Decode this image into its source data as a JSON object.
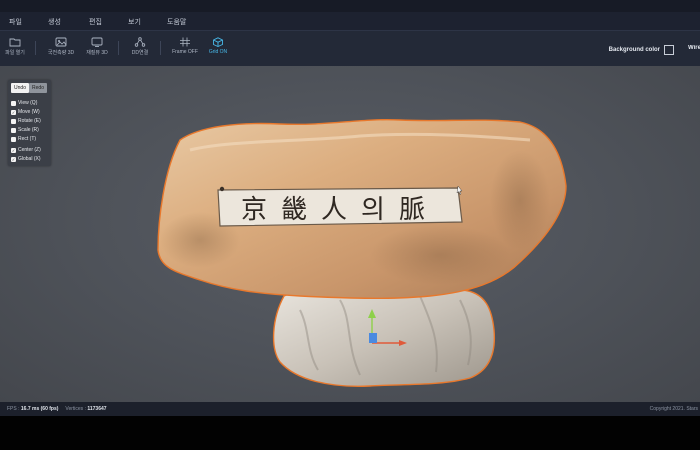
{
  "menu": [
    "파일",
    "생성",
    "편집",
    "보기",
    "도움말"
  ],
  "toolbar": {
    "open_label": "파일 열기",
    "dim3d_label": "국전측량 3D",
    "display3d_label": "재질뷰 3D",
    "graph_label": "DD연결",
    "frame_label": "Frame OFF",
    "grid_label": "Grid ON",
    "bg_color_label": "Background color",
    "wireframe_label": "Wiref"
  },
  "panel": {
    "undo": "Undo",
    "redo": "Redo",
    "options": [
      {
        "label": "View (Q)",
        "checked": false
      },
      {
        "label": "Move (W)",
        "checked": true
      },
      {
        "label": "Rotate (E)",
        "checked": false
      },
      {
        "label": "Scale (R)",
        "checked": false
      },
      {
        "label": "Rect (T)",
        "checked": false
      }
    ],
    "options2": [
      {
        "label": "Center (Z)",
        "checked": true
      },
      {
        "label": "Global (X)",
        "checked": true
      }
    ]
  },
  "model": {
    "inscription": "京畿人의脈"
  },
  "status": {
    "fps_label": "FPS :",
    "fps_value": "16.7 ms (60 fps)",
    "vertices_label": "Vertices :",
    "vertices_value": "1173647",
    "copyright": "Copyright 2021. Stars"
  },
  "colors": {
    "accent": "#48b8e8",
    "selection_outline": "#e8782c",
    "gizmo_x": "#e05a3a",
    "gizmo_y": "#8ed04a",
    "gizmo_z": "#4a8ae0"
  }
}
